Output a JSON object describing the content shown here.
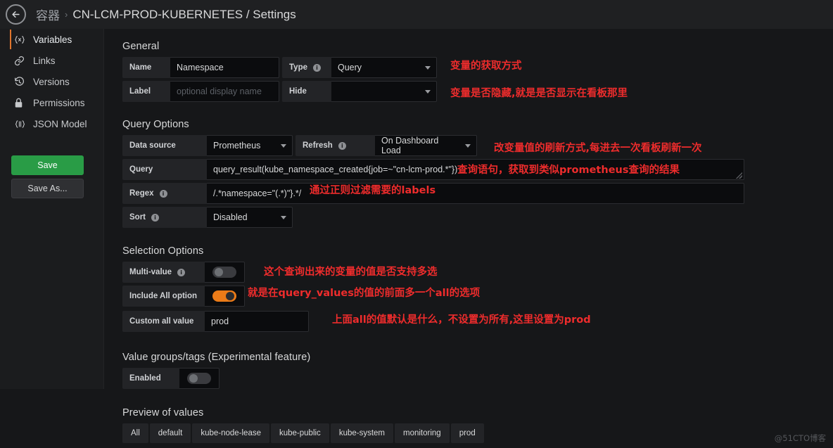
{
  "header": {
    "back_icon": "arrow-left-icon",
    "breadcrumb_root": "容器",
    "breadcrumb_sep": "›",
    "breadcrumb_title": "CN-LCM-PROD-KUBERNETES / Settings"
  },
  "sidebar": {
    "items": [
      {
        "label": "Variables",
        "icon": "variables-icon",
        "active": true
      },
      {
        "label": "Links",
        "icon": "link-icon",
        "active": false
      },
      {
        "label": "Versions",
        "icon": "history-icon",
        "active": false
      },
      {
        "label": "Permissions",
        "icon": "lock-icon",
        "active": false
      },
      {
        "label": "JSON Model",
        "icon": "code-braces-icon",
        "active": false
      }
    ],
    "save_label": "Save",
    "save_as_label": "Save As...",
    "save_color": "#299c46"
  },
  "general": {
    "title": "General",
    "name_label": "Name",
    "name_value": "Namespace",
    "label_label": "Label",
    "label_placeholder": "optional display name",
    "type_label": "Type",
    "type_value": "Query",
    "hide_label": "Hide",
    "hide_value": ""
  },
  "query_options": {
    "title": "Query Options",
    "datasource_label": "Data source",
    "datasource_value": "Prometheus",
    "refresh_label": "Refresh",
    "refresh_value": "On Dashboard Load",
    "query_label": "Query",
    "query_value": "query_result(kube_namespace_created{job=~\"cn-lcm-prod.*\"})",
    "regex_label": "Regex",
    "regex_value": "/.*namespace=\"(.*)\"}.*/",
    "sort_label": "Sort",
    "sort_value": "Disabled"
  },
  "selection_options": {
    "title": "Selection Options",
    "multi_label": "Multi-value",
    "multi_on": false,
    "include_all_label": "Include All option",
    "include_all_on": true,
    "custom_all_label": "Custom all value",
    "custom_all_value": "prod",
    "toggle_on_color": "#eb7b18"
  },
  "value_groups": {
    "title": "Value groups/tags (Experimental feature)",
    "enabled_label": "Enabled",
    "enabled_on": false
  },
  "preview": {
    "title": "Preview of values",
    "values": [
      "All",
      "default",
      "kube-node-lease",
      "kube-public",
      "kube-system",
      "monitoring",
      "prod"
    ]
  },
  "annotations": {
    "color": "#ee2c2c",
    "items": [
      "变量的获取方式",
      "变量是否隐藏,就是是否显示在看板那里",
      "改变量值的刷新方式,每进去一次看板刷新一次",
      "查询语句，获取到类似prometheus查询的结果",
      "通过正则过滤需要的labels",
      "这个查询出来的变量的值是否支持多选",
      "就是在query_values的值的前面多一个all的选项",
      "上面all的值默认是什么，不设置为所有,这里设置为prod"
    ]
  },
  "watermark": "@51CTO博客"
}
